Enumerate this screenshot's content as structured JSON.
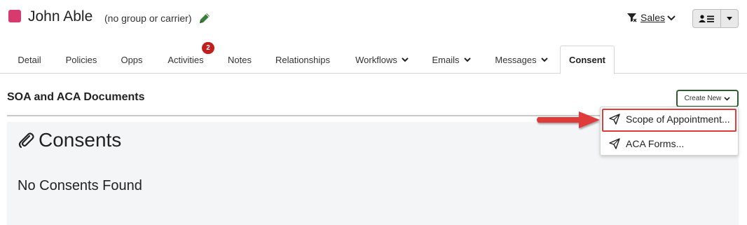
{
  "header": {
    "contact_name": "John Able",
    "group_text": "(no group or carrier)",
    "edit_icon": "pencil-icon",
    "pipeline_label": "Sales",
    "accent_color": "#d63a6e"
  },
  "tabs": [
    {
      "label": "Detail",
      "has_menu": false
    },
    {
      "label": "Policies",
      "has_menu": false
    },
    {
      "label": "Opps",
      "has_menu": false
    },
    {
      "label": "Activities",
      "has_menu": false,
      "badge": "2"
    },
    {
      "label": "Notes",
      "has_menu": false
    },
    {
      "label": "Relationships",
      "has_menu": false
    },
    {
      "label": "Workflows",
      "has_menu": true
    },
    {
      "label": "Emails",
      "has_menu": true
    },
    {
      "label": "Messages",
      "has_menu": true
    },
    {
      "label": "Consent",
      "has_menu": false,
      "active": true
    }
  ],
  "section": {
    "title": "SOA and ACA Documents",
    "create_new_label": "Create New"
  },
  "panel": {
    "heading": "Consents",
    "heading_icon": "paperclip-icon",
    "empty_message": "No Consents Found"
  },
  "dropdown": {
    "items": [
      {
        "label": "Scope of Appointment...",
        "icon": "paper-plane-icon",
        "highlighted": true
      },
      {
        "label": "ACA Forms...",
        "icon": "paper-plane-icon",
        "highlighted": false
      }
    ],
    "highlight_color": "#e03b3b"
  }
}
